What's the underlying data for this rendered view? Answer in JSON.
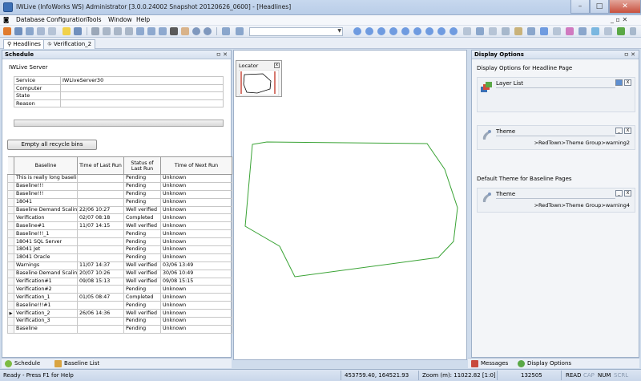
{
  "window": {
    "title": "IWLive (InfoWorks WS) Administrator [3.0.0.24002 Snapshot 20120626_0600] - [Headlines]",
    "minimize": "–",
    "maximize": "□",
    "close": "✕"
  },
  "menu": {
    "items": [
      "Database",
      "Configuration",
      "Tools",
      "Window",
      "Help"
    ],
    "restore": "_ ▫ ✕"
  },
  "doc_tabs": {
    "headlines": "Headlines",
    "verification": "Verification_2"
  },
  "schedule": {
    "title": "Schedule",
    "pin": "ㅁ ✕",
    "server_group": "IWLive Server",
    "info_rows": [
      {
        "label": "Service",
        "value": "IWLiveServer30"
      },
      {
        "label": "Computer",
        "value": ""
      },
      {
        "label": "State",
        "value": ""
      },
      {
        "label": "Reason",
        "value": ""
      }
    ],
    "empty_bins_button": "Empty all recycle bins",
    "columns": [
      "Baseline",
      "Time of Last Run",
      "Status of Last Run",
      "Time of Next Run"
    ],
    "rows": [
      [
        "This is really long baseline",
        "",
        "Pending",
        "Unknown"
      ],
      [
        "Baseline!!!",
        "",
        "Pending",
        "Unknown"
      ],
      [
        "Baseline!!!",
        "",
        "Pending",
        "Unknown"
      ],
      [
        "18041",
        "",
        "Pending",
        "Unknown"
      ],
      [
        "Baseline Demand Scaling",
        "22/06 10:27",
        "Well verified",
        "Unknown"
      ],
      [
        "Verification",
        "02/07 08:18",
        "Completed",
        "Unknown"
      ],
      [
        "Baseline#1",
        "11/07 14:15",
        "Well verified",
        "Unknown"
      ],
      [
        "Baseline!!!_1",
        "",
        "Pending",
        "Unknown"
      ],
      [
        "18041 SQL Server",
        "",
        "Pending",
        "Unknown"
      ],
      [
        "18041 Jet",
        "",
        "Pending",
        "Unknown"
      ],
      [
        "18041 Oracle",
        "",
        "Pending",
        "Unknown"
      ],
      [
        "Warnings",
        "11/07 14:37",
        "Well verified",
        "03/06 13:49"
      ],
      [
        "Baseline Demand Scaling",
        "20/07 10:26",
        "Well verified",
        "30/06 10:49"
      ],
      [
        "Verification#1",
        "09/08 15:13",
        "Well verified",
        "09/08 15:15"
      ],
      [
        "Verification#2",
        "",
        "Pending",
        "Unknown"
      ],
      [
        "Verification_1",
        "01/05 08:47",
        "Completed",
        "Unknown"
      ],
      [
        "Baseline!!!#1",
        "",
        "Pending",
        "Unknown"
      ],
      [
        "Verification_2",
        "26/06 14:36",
        "Well verified",
        "Unknown"
      ],
      [
        "Verification_3",
        "",
        "Pending",
        "Unknown"
      ],
      [
        "Baseline",
        "",
        "Pending",
        "Unknown"
      ]
    ],
    "current_row_marker": "▶"
  },
  "left_bottom_tabs": {
    "schedule": "Schedule",
    "baseline_list": "Baseline List"
  },
  "map": {
    "locator_title": "Locator",
    "locator_close": "x"
  },
  "display_options": {
    "title": "Display Options",
    "pin": "ㅁ ✕",
    "section_headline": "Display Options for Headline Page",
    "layer_list_label": "Layer List",
    "theme_label": "Theme",
    "theme_value": ">RedTown>Theme Group>warning2",
    "section_default": "Default Theme for Baseline Pages",
    "default_theme_label": "Theme",
    "default_theme_value": ">RedTown>Theme Group>warning4",
    "btn_min": "_",
    "btn_close": "X"
  },
  "right_bottom_tabs": {
    "messages": "Messages",
    "display_options": "Display Options"
  },
  "status": {
    "help": "Ready - Press F1 for Help",
    "coords": "453759.40, 164521.93",
    "zoom": "Zoom (m): 11022.82 [1:0]",
    "count": "132505",
    "read": "READ",
    "cap": "CAP",
    "num": "NUM",
    "scrl": "SCRL"
  },
  "colors": {
    "polygon": "#3aa335",
    "accent": "#3c6fb4"
  }
}
